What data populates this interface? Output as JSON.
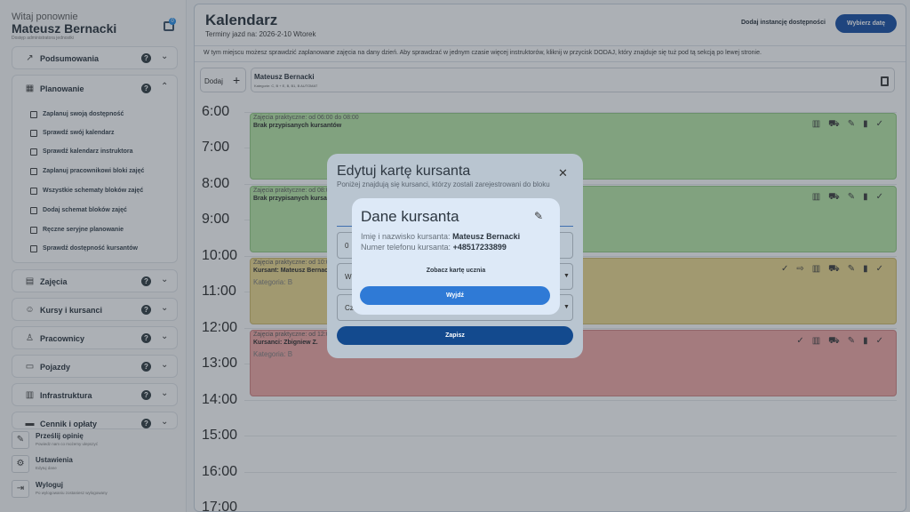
{
  "sidebar": {
    "greeting": "Witaj ponownie",
    "user_name": "Mateusz Bernacki",
    "user_role": "Dostęp administratora jednostki",
    "chat_badge": "0",
    "sections": [
      {
        "label": "Podsumowania",
        "icon": "trend-icon"
      },
      {
        "label": "Planowanie",
        "icon": "calendar-icon",
        "expanded": true
      },
      {
        "label": "Zajęcia",
        "icon": "clipboard-icon"
      },
      {
        "label": "Kursy i kursanci",
        "icon": "face-icon"
      },
      {
        "label": "Pracownicy",
        "icon": "person-icon"
      },
      {
        "label": "Pojazdy",
        "icon": "truck-icon"
      },
      {
        "label": "Infrastruktura",
        "icon": "store-icon"
      },
      {
        "label": "Cennik i opłaty",
        "icon": "card-icon"
      }
    ],
    "planning_items": [
      "Zaplanuj swoją dostępność",
      "Sprawdź swój kalendarz",
      "Sprawdź kalendarz instruktora",
      "Zaplanuj pracownikowi bloki zajęć",
      "Wszystkie schematy bloków zajęć",
      "Dodaj schemat bloków zajęć",
      "Ręczne seryjne planowanie",
      "Sprawdź dostępność kursantów"
    ],
    "footer": [
      {
        "title": "Prześlij opinię",
        "subtitle": "Powiedz nam co możemy ulepszyć",
        "icon": "feedback-icon"
      },
      {
        "title": "Ustawienia",
        "subtitle": "Edytuj dane",
        "icon": "gear-icon"
      },
      {
        "title": "Wyloguj",
        "subtitle": "Po wylogowaniu zostaniesz wylogowany",
        "icon": "logout-icon"
      }
    ]
  },
  "main": {
    "title": "Kalendarz",
    "subtitle": "Terminy jazd na: 2026-2-10 Wtorek",
    "add_availability": "Dodaj instancję dostępności",
    "pick_date": "Wybierz datę",
    "info": "W tym miejscu możesz sprawdzić zaplanowane zajęcia na dany dzień. Aby sprawdzać w jednym czasie więcej instruktorów, kliknij w przycisk DODAJ, który znajduje się tuż pod tą sekcją po lewej stronie.",
    "add_label": "Dodaj",
    "instructor_name": "Mateusz Bernacki",
    "instructor_categories": "Kategorie: C, B + E, B, B1, B AUTOMAT",
    "hours": [
      "6:00",
      "7:00",
      "8:00",
      "9:00",
      "10:00",
      "11:00",
      "12:00",
      "13:00",
      "14:00",
      "15:00",
      "16:00",
      "17:00"
    ]
  },
  "blocks": [
    {
      "time": "Zajęcia praktyczne: od 06:00 do 08:00",
      "name": "Brak przypisanych kursantów",
      "category": ""
    },
    {
      "time": "Zajęcia praktyczne: od 08:00 do 10:00",
      "name": "Brak przypisanych kursantów",
      "category": ""
    },
    {
      "time": "Zajęcia praktyczne: od 10:00 do 12:00",
      "name": "Kursant: Mateusz Bernacki",
      "category": "Kategoria: B"
    },
    {
      "time": "Zajęcia praktyczne: od 12:00 do 14:00",
      "name": "Kursanci: Zbigniew Z.",
      "category": "Kategoria: B"
    }
  ],
  "edit_modal": {
    "title": "Edytuj kartę kursanta",
    "subtitle": "Poniżej znajdują się kursanci, którzy zostali zarejestrowani do bloku",
    "field1_value": "0",
    "field2_value": "W",
    "field3_value": "Cz",
    "save": "Zapisz"
  },
  "details_modal": {
    "title": "Dane kursanta",
    "name_label": "Imię i nazwisko kursanta:",
    "name_value": "Mateusz Bernacki",
    "phone_label": "Numer telefonu kursanta:",
    "phone_value": "+48517233899",
    "view_card": "Zobacz kartę ucznia",
    "exit": "Wyjdź"
  },
  "colors": {
    "primary": "#0d47a1",
    "green_block": "#b6e7a3",
    "yellow_block": "#ecd889",
    "red_block": "#f2a4a1"
  }
}
